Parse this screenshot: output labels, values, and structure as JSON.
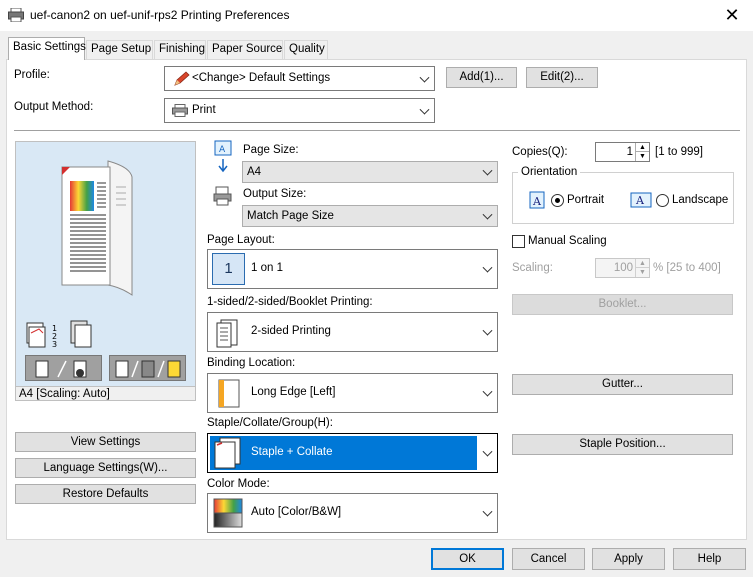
{
  "window": {
    "title": "uef-canon2 on uef-unif-rps2 Printing Preferences",
    "close_symbol": "✕"
  },
  "tabs": [
    "Basic Settings",
    "Page Setup",
    "Finishing",
    "Paper Source",
    "Quality"
  ],
  "profile": {
    "label": "Profile:",
    "value": "<Change> Default Settings",
    "add_label": "Add(1)...",
    "edit_label": "Edit(2)..."
  },
  "output_method": {
    "label": "Output Method:",
    "value": "Print"
  },
  "preview": {
    "status": "A4 [Scaling: Auto]",
    "view_settings": "View Settings",
    "language_settings": "Language Settings(W)...",
    "restore_defaults": "Restore Defaults"
  },
  "page_size": {
    "label": "Page Size:",
    "value": "A4"
  },
  "output_size": {
    "label": "Output Size:",
    "value": "Match Page Size"
  },
  "page_layout": {
    "label": "Page Layout:",
    "value": "1 on 1",
    "icon_text": "1"
  },
  "duplex": {
    "label": "1-sided/2-sided/Booklet Printing:",
    "value": "2-sided Printing"
  },
  "binding": {
    "label": "Binding Location:",
    "value": "Long Edge [Left]"
  },
  "staple": {
    "label": "Staple/Collate/Group(H):",
    "value": "Staple + Collate"
  },
  "color_mode": {
    "label": "Color Mode:",
    "value": "Auto [Color/B&W]"
  },
  "copies": {
    "label": "Copies(Q):",
    "value": "1",
    "range": "[1 to 999]"
  },
  "orientation": {
    "label": "Orientation",
    "portrait": "Portrait",
    "landscape": "Landscape",
    "selected": "portrait"
  },
  "manual_scaling": {
    "label": "Manual Scaling",
    "checked": false
  },
  "scaling": {
    "label": "Scaling:",
    "value": "100",
    "range": "% [25 to 400]"
  },
  "side_buttons": {
    "booklet": "Booklet...",
    "gutter": "Gutter...",
    "staple_position": "Staple Position..."
  },
  "footer": {
    "ok": "OK",
    "cancel": "Cancel",
    "apply": "Apply",
    "help": "Help"
  },
  "colors": {
    "accent": "#0078d7",
    "preview_bg": "#d9e8f5"
  }
}
